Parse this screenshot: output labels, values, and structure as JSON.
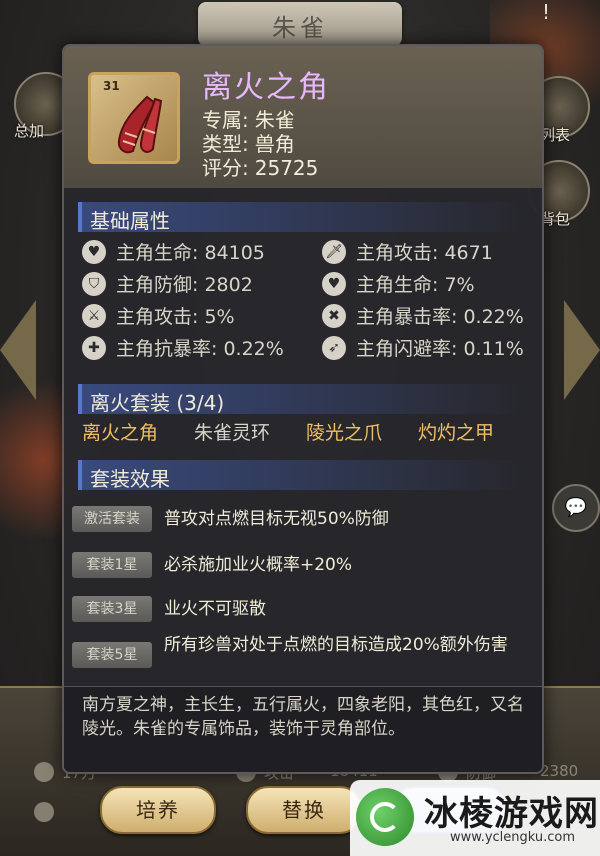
{
  "background": {
    "title": "朱雀",
    "left_label": "总加",
    "right_label_1": "列表",
    "right_label_2": "背包",
    "bottom_stats": [
      "17万",
      "攻击",
      "18411",
      "防御",
      "2380"
    ]
  },
  "item": {
    "level": "31",
    "name": "离火之角",
    "exclusive_label": "专属:",
    "exclusive_value": "朱雀",
    "type_label": "类型:",
    "type_value": "兽角",
    "score_label": "评分:",
    "score_value": "25725"
  },
  "base_attributes": {
    "title": "基础属性",
    "left": [
      {
        "icon": "heart-icon",
        "glyph": "♥",
        "label": "主角生命: 84105"
      },
      {
        "icon": "shield-icon",
        "glyph": "⛉",
        "label": "主角防御: 2802"
      },
      {
        "icon": "attack-icon",
        "glyph": "⚔",
        "label": "主角攻击: 5%"
      },
      {
        "icon": "anti-crit-icon",
        "glyph": "✚",
        "label": "主角抗暴率: 0.22%"
      }
    ],
    "right": [
      {
        "icon": "sword-icon",
        "glyph": "🗡",
        "label": "主角攻击: 4671"
      },
      {
        "icon": "heart-plus-icon",
        "glyph": "♥",
        "label": "主角生命: 7%"
      },
      {
        "icon": "crit-icon",
        "glyph": "✖",
        "label": "主角暴击率: 0.22%"
      },
      {
        "icon": "dodge-icon",
        "glyph": "➶",
        "label": "主角闪避率: 0.11%"
      }
    ]
  },
  "set": {
    "title": "离火套装 (3/4)",
    "pieces": [
      {
        "name": "离火之角",
        "color": "#f0c060"
      },
      {
        "name": "朱雀灵环",
        "color": "#d8d4c8"
      },
      {
        "name": "陵光之爪",
        "color": "#f0c060"
      },
      {
        "name": "灼灼之甲",
        "color": "#f0c060"
      }
    ]
  },
  "set_effects": {
    "title": "套装效果",
    "effects": [
      {
        "tag": "激活套装",
        "text": "普攻对点燃目标无视50%防御"
      },
      {
        "tag": "套装1星",
        "text": "必杀施加业火概率+20%"
      },
      {
        "tag": "套装3星",
        "text": "业火不可驱散"
      },
      {
        "tag": "套装5星",
        "text": "所有珍兽对处于点燃的目标造成20%额外伤害"
      }
    ]
  },
  "description": "南方夏之神，主长生，五行属火，四象老阳，其色红，又名陵光。朱雀的专属饰品，装饰于灵角部位。",
  "buttons": {
    "cultivate": "培养",
    "replace": "替换"
  },
  "watermark": {
    "title": "冰棱游戏网",
    "url": "www.yclengku.com"
  }
}
